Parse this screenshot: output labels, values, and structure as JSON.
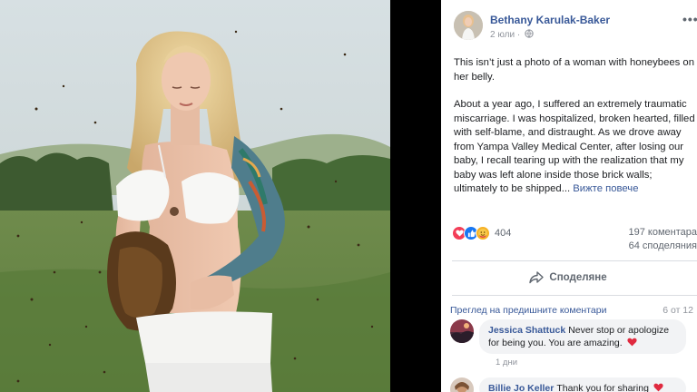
{
  "post": {
    "author": "Bethany Karulak-Baker",
    "timestamp": "2 юли",
    "paragraph1": "This isn’t just a photo of a woman with honeybees on her belly.",
    "paragraph2": "About a year ago, I suffered an extremely traumatic miscarriage. I was hospitalized, broken hearted, filled with self-blame, and distraught. As we drove away from Yampa Valley Medical Center, after losing our baby, I recall tearing up with the realization that my baby was left alone inside those brick walls; ultimately to be shipped...",
    "see_more": "Вижте повече"
  },
  "stats": {
    "reactions": "404",
    "comments": "197 коментара",
    "shares": "64 споделяния"
  },
  "actions": {
    "share_label": "Споделяне"
  },
  "comments_section": {
    "previous_label": "Преглед на предишните коментари",
    "count_label": "6 от 12",
    "items": [
      {
        "author": "Jessica Shattuck",
        "text": "Never stop or apologize for being you. You are amazing.",
        "time": "1 дни"
      },
      {
        "author": "Billie Jo Keller",
        "text": "Thank you for sharing"
      }
    ]
  },
  "colors": {
    "link_blue": "#385898",
    "love_red": "#f33e58",
    "like_blue": "#1877f2",
    "wow_yellow": "#f7b125",
    "heart_red": "#e02a3f"
  }
}
